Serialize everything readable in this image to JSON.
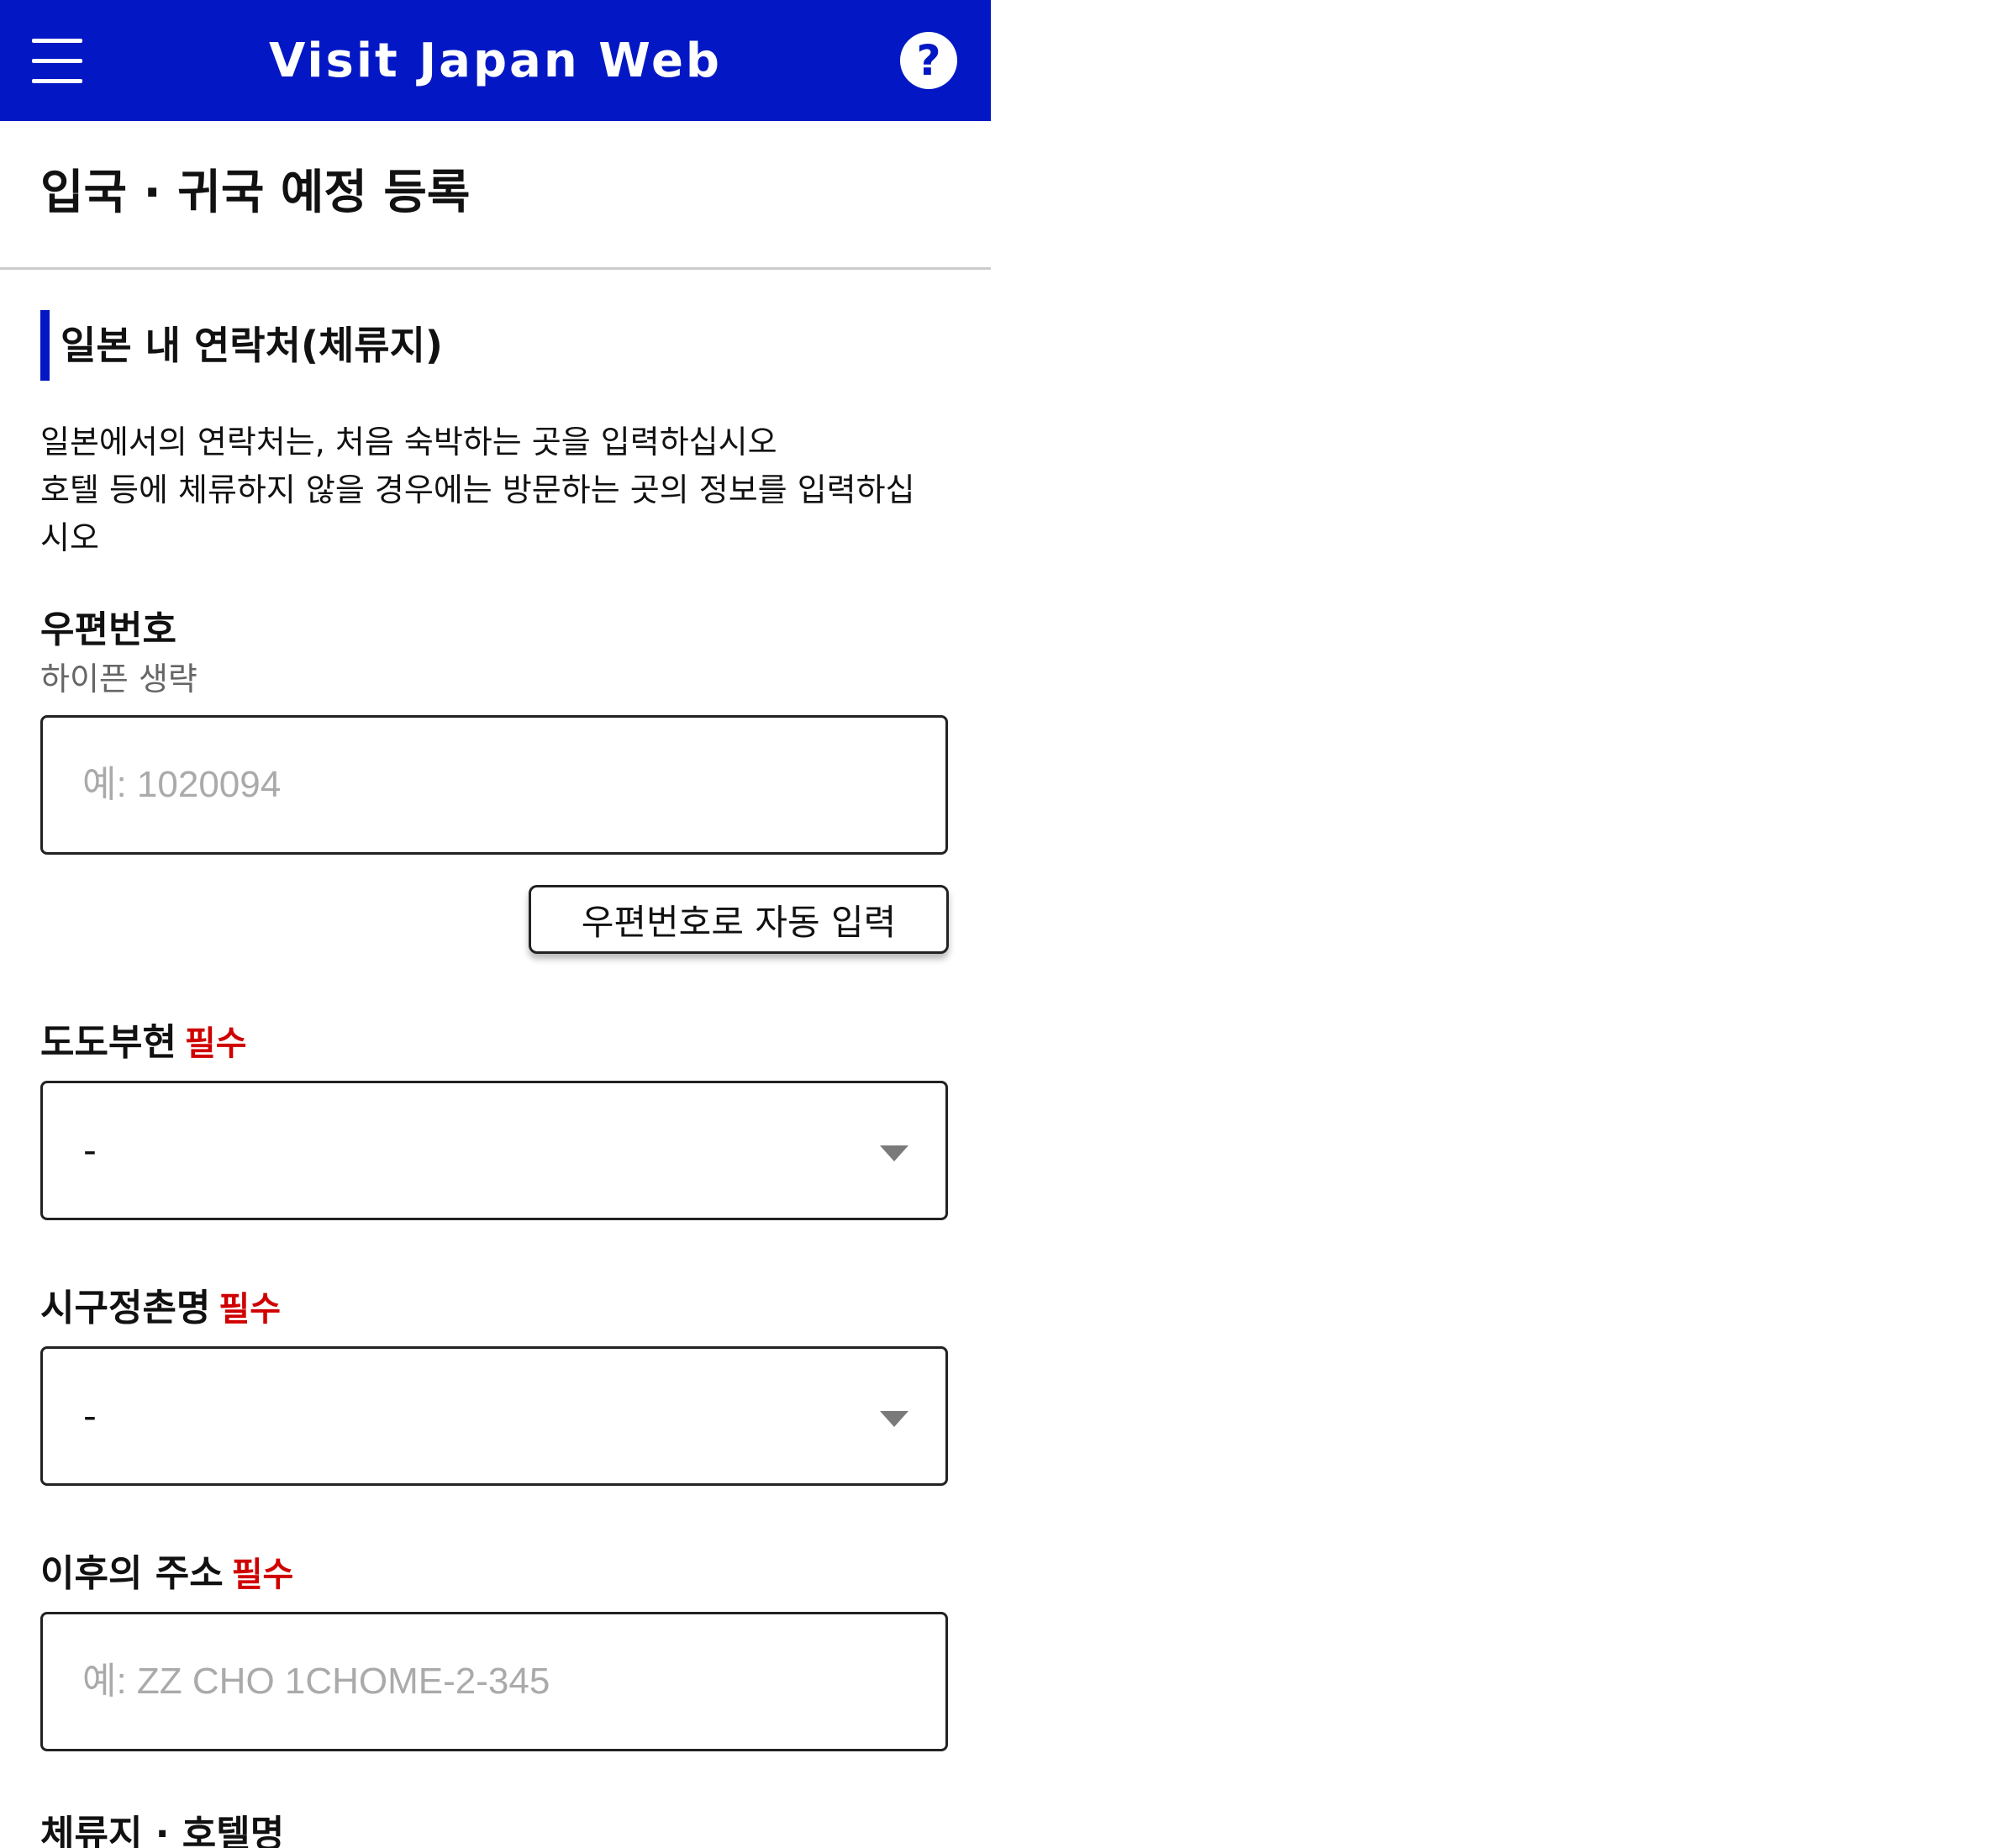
{
  "theme": {
    "brand": "#0318c4",
    "required": "#d00000"
  },
  "header": {
    "title": "Visit Japan Web",
    "menu_icon": "hamburger-menu-icon",
    "help_label": "?"
  },
  "page": {
    "title": "입국 · 귀국 예정 등록"
  },
  "section": {
    "title": "일본 내 연락처(체류지)",
    "description_lines": [
      "일본에서의 연락처는, 처음 숙박하는 곳을 입력하십시오",
      "호텔 등에 체류하지 않을 경우에는 방문하는 곳의 정보를 입력하십",
      "시오"
    ]
  },
  "postal": {
    "label": "우편번호",
    "hint": "하이픈 생략",
    "placeholder": "예: 1020094",
    "value": "",
    "autofill_label": "우편번호로 자동 입력"
  },
  "prefecture": {
    "label": "도도부현",
    "required_label": "필수",
    "value": "-"
  },
  "city": {
    "label": "시구정촌명",
    "required_label": "필수",
    "value": "-"
  },
  "address": {
    "label": "이후의 주소",
    "required_label": "필수",
    "placeholder": "예: ZZ CHO 1CHOME-2-345",
    "value": ""
  },
  "hotel": {
    "label": "체류지 · 호텔명"
  }
}
